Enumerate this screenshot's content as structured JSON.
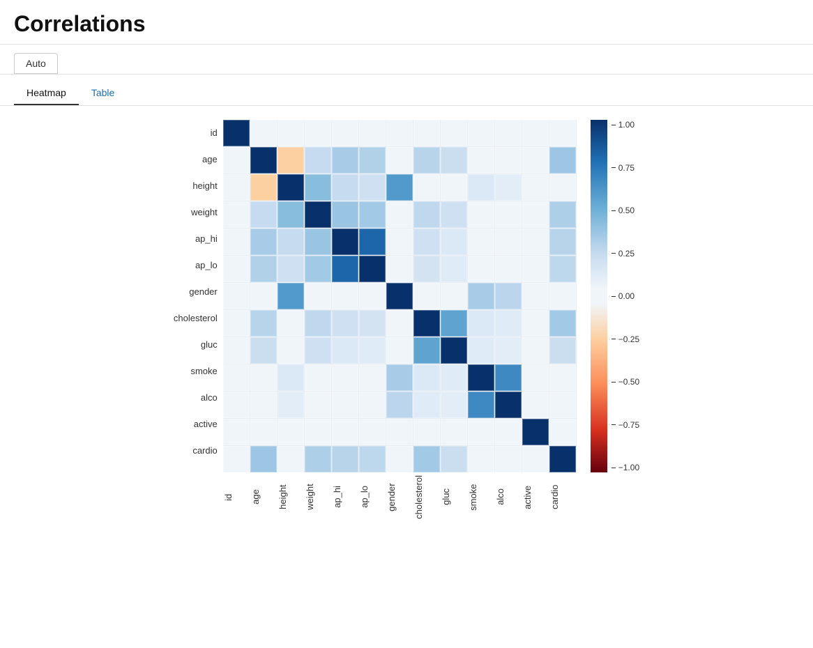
{
  "header": {
    "title": "Correlations"
  },
  "tabs_outer": {
    "auto_label": "Auto"
  },
  "view_tabs": [
    {
      "label": "Heatmap",
      "active": true
    },
    {
      "label": "Table",
      "active": false
    }
  ],
  "heatmap": {
    "variables": [
      "id",
      "age",
      "height",
      "weight",
      "ap_hi",
      "ap_lo",
      "gender",
      "cholesterol",
      "gluc",
      "smoke",
      "alco",
      "active",
      "cardio"
    ],
    "colorbar_labels": [
      "1.00",
      "0.75",
      "0.50",
      "0.25",
      "0.00",
      "−0.25",
      "−0.50",
      "−0.75",
      "−1.00"
    ],
    "cell_size": 38,
    "correlations": [
      [
        1.0,
        0.0,
        0.0,
        0.0,
        0.0,
        0.0,
        0.0,
        0.0,
        0.0,
        0.0,
        0.0,
        0.0,
        0.0
      ],
      [
        0.0,
        1.0,
        -0.1,
        0.1,
        0.2,
        0.17,
        0.0,
        0.15,
        0.09,
        0.0,
        0.0,
        0.0,
        0.24
      ],
      [
        0.0,
        -0.1,
        1.0,
        0.3,
        0.1,
        0.08,
        0.5,
        0.0,
        0.0,
        0.05,
        0.03,
        0.0,
        0.0
      ],
      [
        0.0,
        0.1,
        0.3,
        1.0,
        0.25,
        0.22,
        0.0,
        0.12,
        0.08,
        0.0,
        0.0,
        0.0,
        0.18
      ],
      [
        0.0,
        0.2,
        0.1,
        0.25,
        1.0,
        0.75,
        0.0,
        0.08,
        0.05,
        0.0,
        0.0,
        0.0,
        0.15
      ],
      [
        0.0,
        0.17,
        0.08,
        0.22,
        0.75,
        1.0,
        0.0,
        0.07,
        0.04,
        0.0,
        0.0,
        0.0,
        0.13
      ],
      [
        0.0,
        0.0,
        0.5,
        0.0,
        0.0,
        0.0,
        1.0,
        0.0,
        0.0,
        0.2,
        0.14,
        0.0,
        0.0
      ],
      [
        0.0,
        0.15,
        0.0,
        0.12,
        0.08,
        0.07,
        0.0,
        1.0,
        0.45,
        0.05,
        0.04,
        0.0,
        0.22
      ],
      [
        0.0,
        0.09,
        0.0,
        0.08,
        0.05,
        0.04,
        0.0,
        0.45,
        1.0,
        0.04,
        0.03,
        0.0,
        0.09
      ],
      [
        0.0,
        0.0,
        0.05,
        0.0,
        0.0,
        0.0,
        0.2,
        0.05,
        0.04,
        1.0,
        0.58,
        0.0,
        0.0
      ],
      [
        0.0,
        0.0,
        0.03,
        0.0,
        0.0,
        0.0,
        0.14,
        0.04,
        0.03,
        0.58,
        1.0,
        0.0,
        0.0
      ],
      [
        0.0,
        0.0,
        0.0,
        0.0,
        0.0,
        0.0,
        0.0,
        0.0,
        0.0,
        0.0,
        0.0,
        1.0,
        0.0
      ],
      [
        0.0,
        0.24,
        0.0,
        0.18,
        0.15,
        0.13,
        0.0,
        0.22,
        0.09,
        0.0,
        0.0,
        0.0,
        1.0
      ]
    ]
  }
}
